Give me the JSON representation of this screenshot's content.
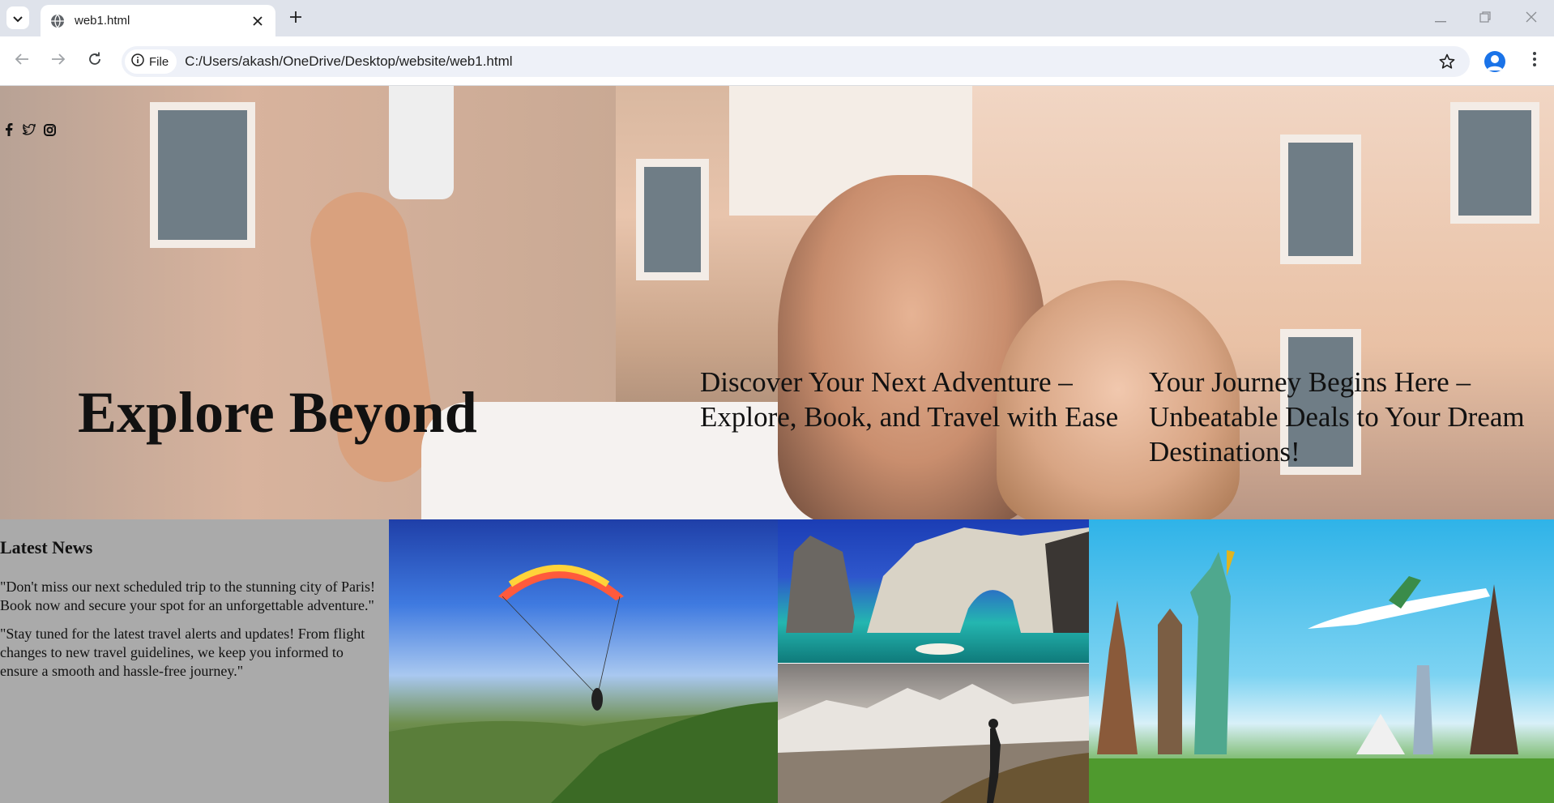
{
  "browser": {
    "tab_title": "web1.html",
    "chip_label": "File",
    "url": "C:/Users/akash/OneDrive/Desktop/website/web1.html"
  },
  "hero": {
    "social_icons": [
      "facebook-icon",
      "twitter-icon",
      "instagram-icon"
    ],
    "title": "Explore Beyond",
    "tagline_1": "Discover Your Next Adventure – Explore, Book, and Travel with Ease",
    "tagline_2": "Your Journey Begins Here – Unbeatable Deals to Your Dream Destinations!"
  },
  "news": {
    "heading": "Latest News",
    "items": [
      "\"Don't miss our next scheduled trip to the stunning city of Paris! Book now and secure your spot for an unforgettable adventure.\"",
      "\"Stay tuned for the latest travel alerts and updates! From flight changes to new travel guidelines, we keep you informed to ensure a smooth and hassle-free journey.\""
    ]
  },
  "colors": {
    "tabbar_bg": "#dfe3eb",
    "news_bg": "#aaaaaa",
    "accent": "#1a73e8"
  }
}
